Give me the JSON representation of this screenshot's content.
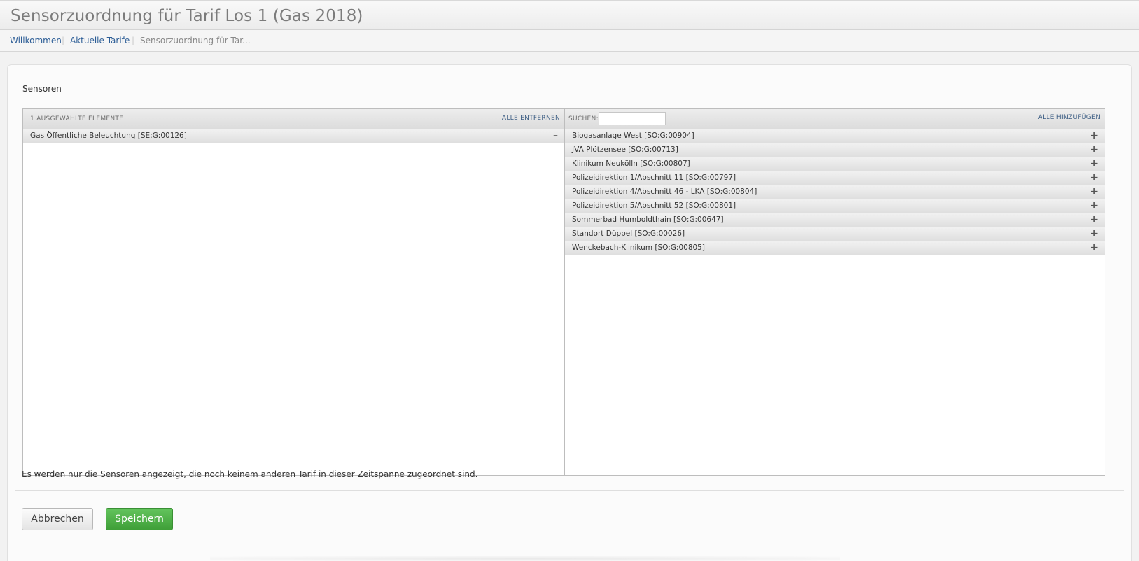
{
  "page": {
    "title": "Sensorzuordnung für Tarif Los 1 (Gas 2018)"
  },
  "breadcrumb": {
    "items": [
      {
        "label": "Willkommen"
      },
      {
        "label": "Aktuelle Tarife"
      },
      {
        "label": "Sensorzuordnung für Tar..."
      }
    ],
    "separator": "|"
  },
  "form": {
    "section_label": "Sensoren",
    "note": "Es werden nur die Sensoren angezeigt, die noch keinem anderen Tarif in dieser Zeitspanne zugeordnet sind.",
    "cancel_label": "Abbrechen",
    "save_label": "Speichern"
  },
  "selected": {
    "count_label": "1 ausgewählte Elemente",
    "remove_all_label": "Alle entfernen",
    "remove_icon": "minus-icon",
    "items": [
      {
        "label": "Gas Öffentliche Beleuchtung [SE:G:00126]"
      }
    ]
  },
  "available": {
    "search_label": "Suchen:",
    "search_value": "",
    "add_all_label": "Alle hinzufügen",
    "add_icon": "plus-icon",
    "items": [
      {
        "label": "Biogasanlage West [SO:G:00904]"
      },
      {
        "label": "JVA Plötzensee [SO:G:00713]"
      },
      {
        "label": "Klinikum Neukölln [SO:G:00807]"
      },
      {
        "label": "Polizeidirektion 1/Abschnitt 11 [SO:G:00797]"
      },
      {
        "label": "Polizeidirektion 4/Abschnitt 46 - LKA [SO:G:00804]"
      },
      {
        "label": "Polizeidirektion 5/Abschnitt 52 [SO:G:00801]"
      },
      {
        "label": "Sommerbad Humboldthain [SO:G:00647]"
      },
      {
        "label": "Standort Düppel [SO:G:00026]"
      },
      {
        "label": "Wenckebach-Klinikum [SO:G:00805]"
      }
    ]
  },
  "colors": {
    "link": "#2c5d96",
    "save_button": "#4cae45"
  }
}
